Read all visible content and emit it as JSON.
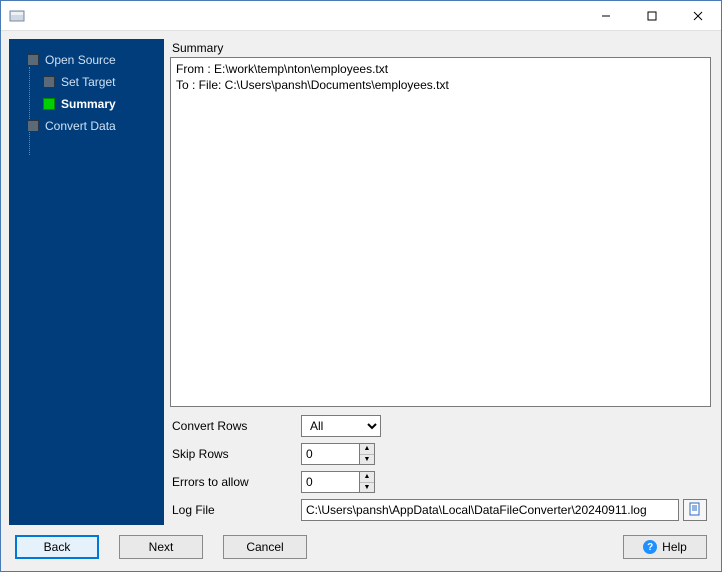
{
  "window": {
    "title": ""
  },
  "sidebar": {
    "steps": [
      {
        "label": "Open Source"
      },
      {
        "label": "Set Target"
      },
      {
        "label": "Summary"
      },
      {
        "label": "Convert Data"
      }
    ],
    "active_index": 2
  },
  "main": {
    "section_label": "Summary",
    "summary_lines": [
      "From : E:\\work\\temp\\nton\\employees.txt",
      "To : File: C:\\Users\\pansh\\Documents\\employees.txt"
    ],
    "options": {
      "convert_rows_label": "Convert Rows",
      "convert_rows_value": "All",
      "skip_rows_label": "Skip Rows",
      "skip_rows_value": "0",
      "errors_label": "Errors to allow",
      "errors_value": "0",
      "log_label": "Log File",
      "log_value": "C:\\Users\\pansh\\AppData\\Local\\DataFileConverter\\20240911.log"
    }
  },
  "footer": {
    "back": "Back",
    "next": "Next",
    "cancel": "Cancel",
    "help": "Help"
  }
}
